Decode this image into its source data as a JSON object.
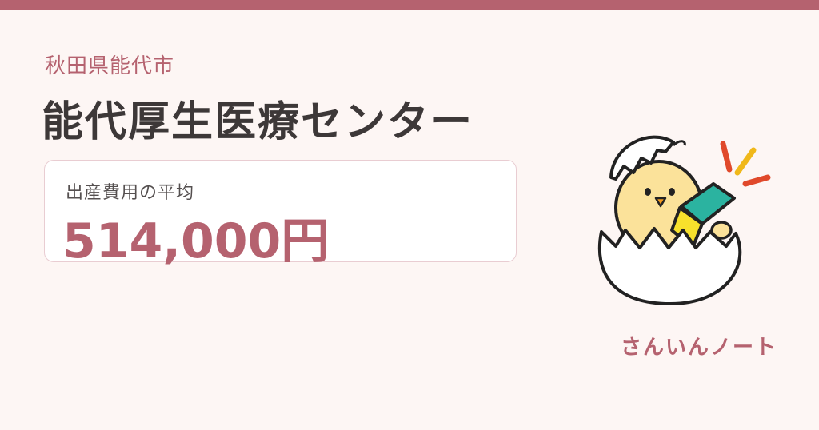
{
  "header": {
    "accent_color": "#b5626f"
  },
  "location": {
    "prefecture_city": "秋田県能代市"
  },
  "hospital": {
    "name": "能代厚生医療センター"
  },
  "cost": {
    "label": "出産費用の平均",
    "value": "514,000円"
  },
  "brand": {
    "name": "さんいんノート",
    "mascot": "chick-in-eggshell-reading-icon"
  }
}
